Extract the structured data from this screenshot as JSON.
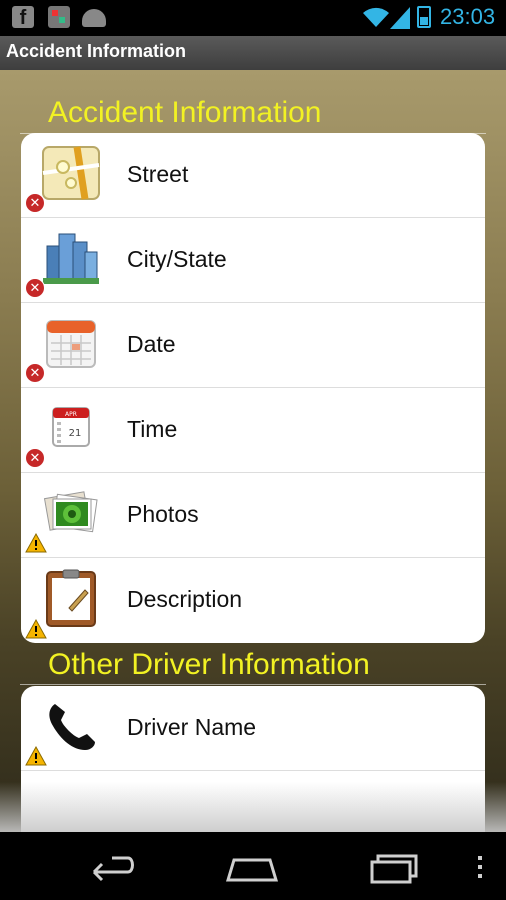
{
  "status_bar": {
    "time": "23:03",
    "notification_icons": [
      "facebook-icon",
      "app-icon",
      "android-icon"
    ],
    "system_icons": [
      "wifi-icon",
      "signal-icon",
      "battery-charging-icon"
    ],
    "accent_color": "#33b5e5"
  },
  "action_bar": {
    "title": "Accident Information"
  },
  "sections": [
    {
      "header": "Accident Information",
      "items": [
        {
          "label": "Street",
          "icon": "map-icon",
          "status": "error"
        },
        {
          "label": "City/State",
          "icon": "city-buildings-icon",
          "status": "error"
        },
        {
          "label": "Date",
          "icon": "calendar-icon",
          "status": "error"
        },
        {
          "label": "Time",
          "icon": "calendar-day-icon",
          "status": "error"
        },
        {
          "label": "Photos",
          "icon": "photos-icon",
          "status": "warning"
        },
        {
          "label": "Description",
          "icon": "clipboard-icon",
          "status": "warning"
        }
      ]
    },
    {
      "header": "Other Driver Information",
      "items": [
        {
          "label": "Driver Name",
          "icon": "phone-icon",
          "status": "warning"
        }
      ]
    }
  ],
  "calendar_day": {
    "month": "APR",
    "day": "21"
  },
  "colors": {
    "section_header": "#f2f223",
    "error_badge": "#c62828",
    "warning_badge": "#f5b400",
    "card_background": "#ffffff"
  },
  "nav_bar": {
    "buttons": [
      "back-icon",
      "home-icon",
      "recents-icon",
      "overflow-menu-icon"
    ]
  }
}
